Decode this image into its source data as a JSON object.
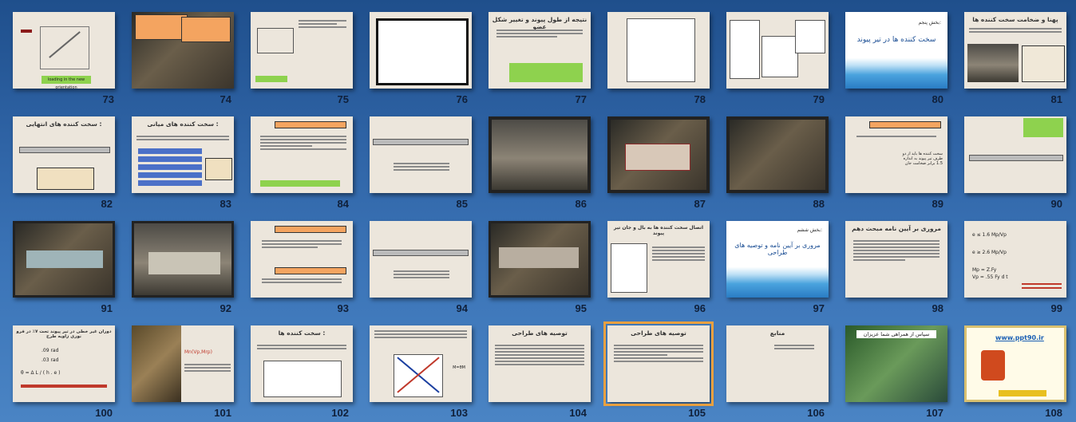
{
  "slide_sorter": {
    "numbers": [
      "73",
      "74",
      "75",
      "76",
      "77",
      "78",
      "79",
      "80",
      "81",
      "82",
      "83",
      "84",
      "85",
      "86",
      "87",
      "88",
      "89",
      "90",
      "91",
      "92",
      "93",
      "94",
      "95",
      "96",
      "97",
      "98",
      "99",
      "100",
      "101",
      "102",
      "103",
      "104",
      "105",
      "106",
      "107",
      "108"
    ],
    "selected": "105"
  },
  "slides": {
    "s73_caption": "loading in the new orientation",
    "s77_title": "نتیجه از طول پیوند و تغییر شکل عضو",
    "s80_title": "سخت کننده ها در تیر پیوند",
    "s80_header": "بخش پنجم:",
    "s81_title": "پهنا و ضخامت سخت کننده ها",
    "s82_title": "سخت کننده های انتهایی :",
    "s83_title": "سخت کننده های میانی :",
    "s89_text": "سخت کننده ها باید از دو طرف تیر پیوند به اندازه 1.5 برابر ضخامت جان",
    "s96_title": "اتصال سخت کننده ها به بال و جان تیر پیوند",
    "s97_header": "بخش ششم:",
    "s97_title": "مروری بر آیین نامه و توصیه های طراحی",
    "s98_title": "مروری بر آیین نامه مبحث دهم",
    "s99_line1": "e ≤ 1.6 Mp/Vp",
    "s99_line2": "e ≥ 2.6 Mp/Vp",
    "s99_line3": "Mp = Z.Fy",
    "s99_line4": "Vp = .55 Fy d t",
    "s100_title": "دوران غیر خطی در تیر پیوند تحت ۷٪ در فرو نوری زاویه طرح",
    "s100_v1": ".09 rad",
    "s100_v2": ".03 rad",
    "s100_formula": "θ = Δ L / ( h . e )",
    "s101_formula": "Mn(Vp,Mrp)",
    "s102_title": "سخت کننده ها :",
    "s103_label": "M=θM",
    "s104_title": "توصیه های طراحی",
    "s105_title": "توصیه های طراحی",
    "s106_title": "منابع",
    "s107_title": "سپاس از همراهی شما عزیزان",
    "s108_link": "www.ppt90.ir"
  },
  "colors": {
    "selected_outline": "#e8a040",
    "background_top": "#1f4f8c",
    "background_bottom": "#4a84c4"
  }
}
